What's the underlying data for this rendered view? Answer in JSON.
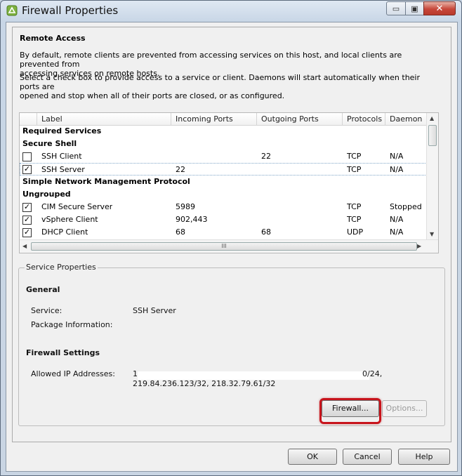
{
  "window": {
    "title": "Firewall Properties",
    "min_glyph": "▭",
    "max_glyph": "▣",
    "close_glyph": "✕"
  },
  "remote_access": {
    "title": "Remote Access",
    "desc1_line1": "By default, remote clients are prevented from accessing services on this host, and local clients are prevented from",
    "desc1_line2": "accessing services on remote hosts.",
    "desc2_line1": "Select a check box to provide access to a service or client. Daemons will start automatically when their ports are",
    "desc2_line2": "opened and stop when all of their ports are closed, or as configured."
  },
  "table": {
    "columns": [
      "Label",
      "Incoming Ports",
      "Outgoing Ports",
      "Protocols",
      "Daemon"
    ],
    "rows": [
      {
        "type": "group",
        "label": "Required Services"
      },
      {
        "type": "group",
        "label": "Secure Shell"
      },
      {
        "type": "item",
        "checked": false,
        "label": "SSH Client",
        "incoming": "",
        "outgoing": "22",
        "protocols": "TCP",
        "daemon": "N/A"
      },
      {
        "type": "item",
        "checked": true,
        "label": "SSH Server",
        "incoming": "22",
        "outgoing": "",
        "protocols": "TCP",
        "daemon": "N/A",
        "selected": true
      },
      {
        "type": "group",
        "label": "Simple Network Management Protocol"
      },
      {
        "type": "group",
        "label": "Ungrouped"
      },
      {
        "type": "item",
        "checked": true,
        "label": "CIM Secure Server",
        "incoming": "5989",
        "outgoing": "",
        "protocols": "TCP",
        "daemon": "Stopped"
      },
      {
        "type": "item",
        "checked": true,
        "label": "vSphere Client",
        "incoming": "902,443",
        "outgoing": "",
        "protocols": "TCP",
        "daemon": "N/A"
      },
      {
        "type": "item",
        "checked": true,
        "label": "DHCP Client",
        "incoming": "68",
        "outgoing": "68",
        "protocols": "UDP",
        "daemon": "N/A"
      }
    ],
    "hscroll_grip": "III",
    "check_glyph": "✓"
  },
  "service_properties": {
    "legend": "Service Properties",
    "general_title": "General",
    "service_label": "Service:",
    "service_value": "SSH Server",
    "package_label": "Package Information:",
    "package_value": "",
    "firewall_title": "Firewall Settings",
    "allowed_label": "Allowed IP Addresses:",
    "allowed_line1_start": "1",
    "allowed_line1_end": "0/24,",
    "allowed_line2": "219.84.236.123/32, 218.32.79.61/32",
    "firewall_button": "Firewall...",
    "options_button": "Options..."
  },
  "footer": {
    "ok": "OK",
    "cancel": "Cancel",
    "help": "Help"
  },
  "colors": {
    "highlight": "#c8141c",
    "window_bg": "#c7d3e2"
  }
}
